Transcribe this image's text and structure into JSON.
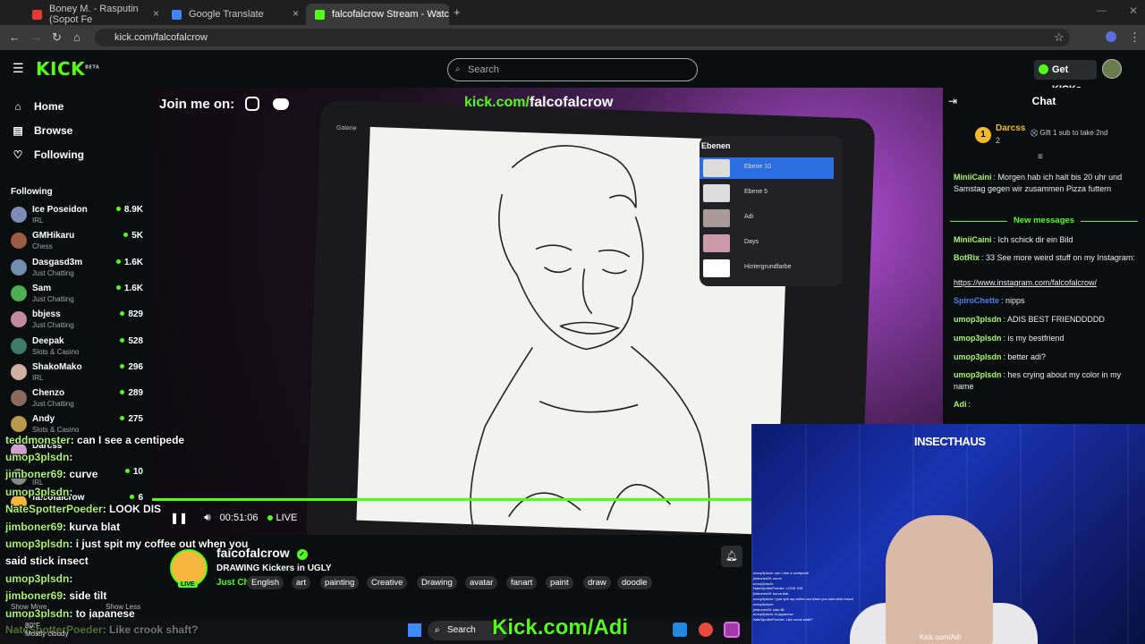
{
  "browser": {
    "tabs": [
      {
        "label": "Boney M. - Rasputin (Sopot Fe",
        "color": "#e53935"
      },
      {
        "label": "Google Translate",
        "color": "#4285f4"
      },
      {
        "label": "falcofalcrow Stream - Watc",
        "color": "#53fc18"
      }
    ],
    "url": "kick.com/falcofalcrow"
  },
  "header": {
    "logo": "KICK",
    "logo_badge": "BETA",
    "search_placeholder": "Search",
    "get_kicks": "Get KICKs"
  },
  "sidebar": {
    "nav": [
      {
        "label": "Home",
        "icon": "home-icon",
        "glyph": "⌂"
      },
      {
        "label": "Browse",
        "icon": "browse-icon",
        "glyph": "▤"
      },
      {
        "label": "Following",
        "icon": "heart-icon",
        "glyph": "♡"
      }
    ],
    "following_title": "Following",
    "channels": [
      {
        "name": "Ice Poseidon",
        "category": "IRL",
        "viewers": "8.9K",
        "color": "#7b8cb8"
      },
      {
        "name": "GMHikaru",
        "category": "Chess",
        "viewers": "5K",
        "color": "#9b5b42"
      },
      {
        "name": "Dasgasd3m",
        "category": "Just Chatting",
        "viewers": "1.6K",
        "color": "#6f8fb0"
      },
      {
        "name": "Sam",
        "category": "Just Chatting",
        "viewers": "1.6K",
        "color": "#4caf50"
      },
      {
        "name": "bbjess",
        "category": "Just Chatting",
        "viewers": "829",
        "color": "#c48aa0"
      },
      {
        "name": "Deepak",
        "category": "Slots & Casino",
        "viewers": "528",
        "color": "#3c7a6a"
      },
      {
        "name": "ShakoMako",
        "category": "IRL",
        "viewers": "296",
        "color": "#d0b0a0"
      },
      {
        "name": "Chenzo",
        "category": "Just Chatting",
        "viewers": "289",
        "color": "#8a6a5a"
      },
      {
        "name": "Andy",
        "category": "Slots & Casino",
        "viewers": "275",
        "color": "#b89a4a"
      },
      {
        "name": "Darcss",
        "category": "",
        "viewers": "",
        "color": "#cfa0d0"
      },
      {
        "name": "",
        "category": "IRL",
        "viewers": "10",
        "color": "#888"
      },
      {
        "name": "falcofalcrow",
        "category": "",
        "viewers": "6",
        "color": "#f6b73c"
      }
    ]
  },
  "video": {
    "join_me": "Join me on:",
    "kick_url_green": "kick.com/",
    "kick_url_white": "falcofalcrow",
    "procreate_gallery": "Galerie",
    "layers_title": "Ebenen",
    "layers": [
      {
        "name": "Ebene 10"
      },
      {
        "name": "Ebene 5"
      },
      {
        "name": "Adi"
      },
      {
        "name": "Days"
      },
      {
        "name": "Hintergrundfarbe"
      }
    ],
    "progress": 0.76,
    "time": "00:51:06",
    "live": "LIVE"
  },
  "streamer": {
    "name": "falcofalcrow",
    "live_badge": "LIVE",
    "title": "DRAWING Kickers in UGLY",
    "category": "Just Chatting",
    "tags": [
      "English",
      "art",
      "painting",
      "Creative",
      "Drawing",
      "avatar",
      "fanart",
      "paint",
      "draw",
      "doodle"
    ]
  },
  "chat": {
    "title": "Chat",
    "pinned": {
      "user": "Darcss",
      "count": "2",
      "text": "Gift 1 sub to take 2nd"
    },
    "messages_before": [
      {
        "user": "MiniiCaini",
        "color": "#a8f56a",
        "text": "Morgen hab ich halt bis 20 uhr und Samstag gegen wir zusammen Pizza futtern"
      }
    ],
    "new_messages": "New messages",
    "messages": [
      {
        "user": "MiniiCaini",
        "color": "#a8f56a",
        "text": "Ich schick dir ein Bild"
      },
      {
        "user": "BotRix",
        "color": "#a8f56a",
        "text": "33 See more weird stuff on my Instagram:"
      },
      {
        "user": "",
        "color": "#a8f56a",
        "text": "https://www.instagram.com/falcofalcrow/"
      },
      {
        "user": "SpiroChette",
        "color": "#4a7ef7",
        "text": "nipps"
      },
      {
        "user": "umop3plsdn",
        "color": "#a8f56a",
        "text": "ADIS BEST FRIENDDDDD"
      },
      {
        "user": "umop3plsdn",
        "color": "#a8f56a",
        "text": "is my bestfriend"
      },
      {
        "user": "umop3plsdn",
        "color": "#a8f56a",
        "text": "better adi?"
      },
      {
        "user": "umop3plsdn",
        "color": "#a8f56a",
        "text": "hes crying about my color in my name"
      },
      {
        "user": "Adi",
        "color": "#a8f56a",
        "text": ""
      }
    ]
  },
  "webcam": {
    "sign": "INSECTHAUS",
    "watermark": "Kick.com/Adi",
    "mini_chat": [
      "umop3plsdn: can I see a centipede",
      "jimboner69: curve",
      "umop3plsdn:",
      "NateSpotterPoeder: LOOK DIS",
      "jimboner69: kurva blat",
      "umop3plsdn: i just spit my coffee out when you said stick insect",
      "umop3plsdn:",
      "jimboner69: side tilt",
      "umop3plsdn: to japanese",
      "NateSpotterPoeder: Like crook shaft?"
    ]
  },
  "overlay_chat": [
    {
      "user": "teddmonster",
      "text": "can I see a centipede"
    },
    {
      "user": "umop3plsdn",
      "text": ""
    },
    {
      "user": "jimboner69",
      "text": "curve"
    },
    {
      "user": "umop3plsdn",
      "text": ""
    },
    {
      "user": "NateSpotterPoeder",
      "text": "LOOK DIS"
    },
    {
      "user": "jimboner69",
      "text": "kurva blat"
    },
    {
      "user": "umop3plsdn",
      "text": "i just spit my coffee out when you"
    },
    {
      "user": "",
      "text": "said stick insect"
    },
    {
      "user": "umop3plsdn",
      "text": ""
    },
    {
      "user": "jimboner69",
      "text": "side tilt"
    },
    {
      "user": "umop3plsdn",
      "text": "to japanese"
    },
    {
      "user": "NateSpotterPoeder",
      "text": "Like crook shaft?"
    }
  ],
  "sidebar_footer": {
    "show_more": "Show More",
    "show_less": "Show Less"
  },
  "taskbar": {
    "temp": "80°F",
    "weather": "Mostly cloudy",
    "search": "Search"
  },
  "big_watermark": "Kick.com/Adi"
}
